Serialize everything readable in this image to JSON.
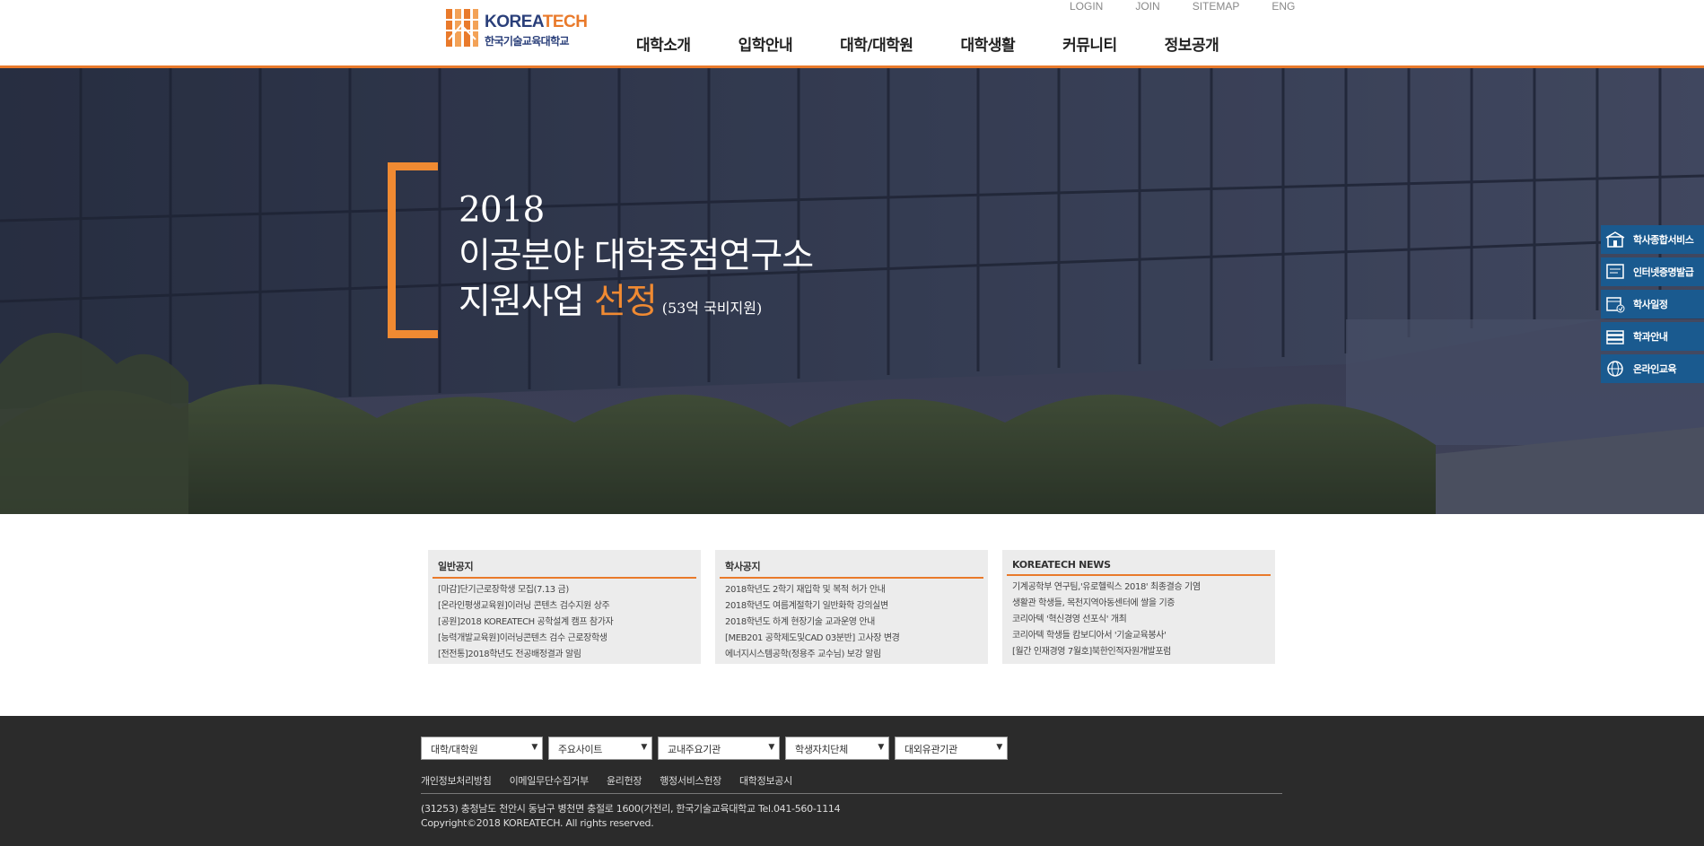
{
  "header": {
    "logo_en_a": "KOREA",
    "logo_en_b": "TECH",
    "logo_ko": "한국기술교육대학교",
    "util": [
      "LOGIN",
      "JOIN",
      "SITEMAP",
      "ENG"
    ],
    "nav": [
      "대학소개",
      "입학안내",
      "대학/대학원",
      "대학생활",
      "커뮤니티",
      "정보공개"
    ]
  },
  "hero": {
    "line1": "2018",
    "line2": "이공분야 대학중점연구소",
    "line3_a": "지원사업",
    "line3_b": "선정",
    "line3_small": "(53억 국비지원)"
  },
  "quick_menu": [
    {
      "label": "학사종합서비스",
      "icon": "building-icon"
    },
    {
      "label": "인터넷증명발급",
      "icon": "certificate-icon"
    },
    {
      "label": "학사일정",
      "icon": "calendar-icon"
    },
    {
      "label": "학과안내",
      "icon": "books-icon"
    },
    {
      "label": "온라인교육",
      "icon": "globe-icon"
    }
  ],
  "boards": [
    {
      "title": "일반공지",
      "items": [
        "[마감]단기근로장학생 모집(7.13 금)",
        "[온라인평생교육원]이러닝 콘텐츠 검수지원 상주",
        "[공원]2018 KOREATECH 공학설계 캠프 참가자",
        "[능력개발교육원]이러닝콘텐츠 검수 근로장학생",
        "[전전통]2018학년도 전공배정결과 알림"
      ]
    },
    {
      "title": "학사공지",
      "items": [
        "2018학년도 2학기 재입학 및 복적 허가 안내",
        "2018학년도 여름계절학기 일반화학 강의실변",
        "2018학년도 하계 현장기술 교과운영 안내",
        "[MEB201 공학제도및CAD 03분반] 고사장 변경",
        "에너지시스템공학(정용주 교수님) 보강 알림"
      ]
    },
    {
      "title": "KOREATECH NEWS",
      "items": [
        "기계공학부 연구팀,'유로헬릭스 2018' 최종결승 기염",
        "생활관 학생들, 목천지역아동센터에 쌀을 기증",
        "코리아텍 '혁신경영 선포식' 개최",
        "코리아텍 학생들 캄보디아서 '기술교육봉사'",
        "[월간 인재경영 7월호]북한인적자원개발포럼"
      ]
    }
  ],
  "footer": {
    "selects": [
      "대학/대학원",
      "주요사이트",
      "교내주요기관",
      "학생자치단체",
      "대외유관기관"
    ],
    "links": [
      "개인정보처리방침",
      "이메일무단수집거부",
      "윤리헌장",
      "행정서비스헌장",
      "대학정보공시"
    ],
    "address": "(31253) 충청남도 천안시 동남구 병천면 충절로 1600(가전리, 한국기술교육대학교 Tel.041-560-1114",
    "copyright": "Copyright©2018 KOREATECH. All rights reserved."
  },
  "colors": {
    "accent": "#e97a2b",
    "quick_menu_bg": "#1a5a8f",
    "footer_bg": "#2b2b2b"
  }
}
